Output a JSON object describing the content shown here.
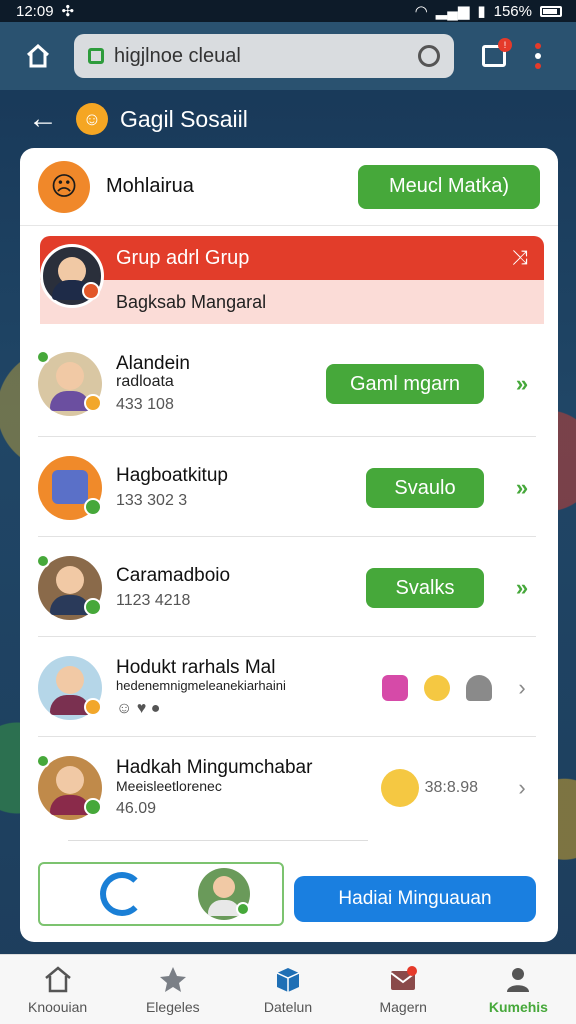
{
  "status_bar": {
    "time": "12:09",
    "battery": "156%"
  },
  "browser": {
    "url": "higjlnoe cleual"
  },
  "page": {
    "title": "Gagil Sosaiil"
  },
  "card_header": {
    "name": "Mohlairua",
    "button_label": "Meucl Matka)"
  },
  "highlight_group": {
    "title": "Grup adrl Grup",
    "subtitle": "Bagksab Mangaral"
  },
  "rows": [
    {
      "title": "Alandein",
      "subtitle": "radloata",
      "meta": "433 108",
      "button_label": "Gaml mgarn"
    },
    {
      "title": "Hagboatkitup",
      "meta": "133 302 3",
      "button_label": "Svaulo"
    },
    {
      "title": "Caramadboio",
      "meta": "1123 4218",
      "button_label": "Svalks"
    },
    {
      "title": "Hodukt rarhals Mal",
      "subtitle": "hedenemnigmeleanekiarhaini"
    },
    {
      "title": "Hadkah Mingumchabar",
      "subtitle": "Meeisleetlorenec",
      "meta": "46.09",
      "extra": "38:8.98"
    }
  ],
  "cta": {
    "label": "Hadiai Minguauan"
  },
  "bottom_nav": [
    {
      "label": "Knoouian"
    },
    {
      "label": "Elegeles"
    },
    {
      "label": "Datelun"
    },
    {
      "label": "Magern"
    },
    {
      "label": "Kumehis"
    }
  ],
  "colors": {
    "accent_green": "#46a83a",
    "accent_red": "#e23d2a",
    "accent_blue": "#1a7fe0"
  }
}
